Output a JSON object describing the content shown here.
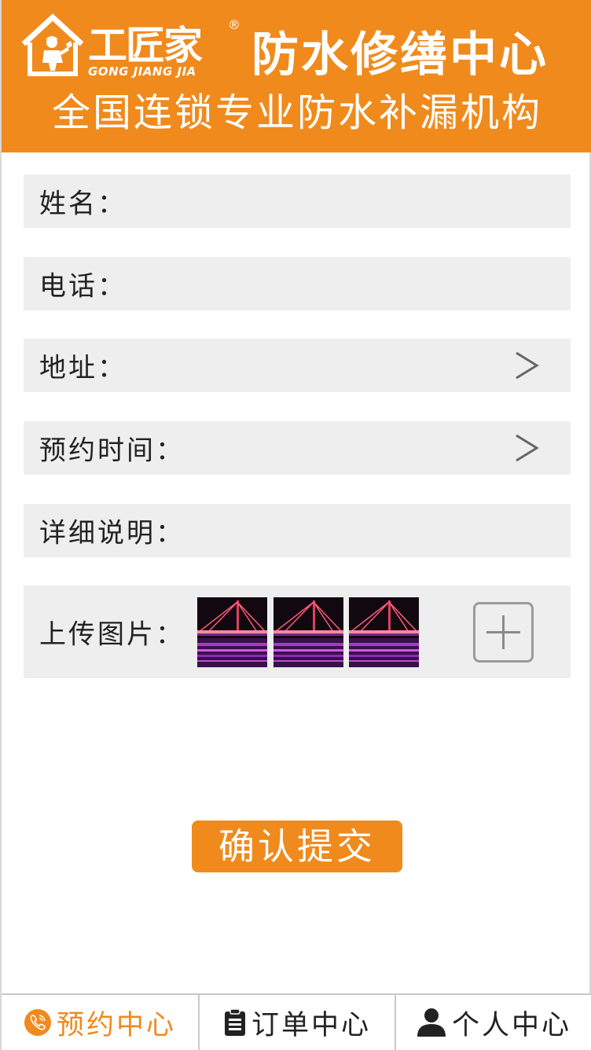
{
  "header": {
    "logo_text": "工匠家",
    "logo_sub": "GONG JIANG JIA",
    "logo_reg": "®",
    "title": "防水修缮中心",
    "slogan": "全国连锁专业防水补漏机构"
  },
  "form": {
    "name_label": "姓名：",
    "phone_label": "电话：",
    "address_label": "地址：",
    "time_label": "预约时间：",
    "detail_label": "详细说明：",
    "upload_label": "上传图片："
  },
  "submit_label": "确认提交",
  "tabs": [
    {
      "label": "预约中心",
      "icon": "phone-icon",
      "active": true
    },
    {
      "label": "订单中心",
      "icon": "clipboard-icon",
      "active": false
    },
    {
      "label": "个人中心",
      "icon": "person-icon",
      "active": false
    }
  ],
  "colors": {
    "brand": "#f08a1c",
    "row_bg": "#eeeeee",
    "text": "#222222"
  }
}
